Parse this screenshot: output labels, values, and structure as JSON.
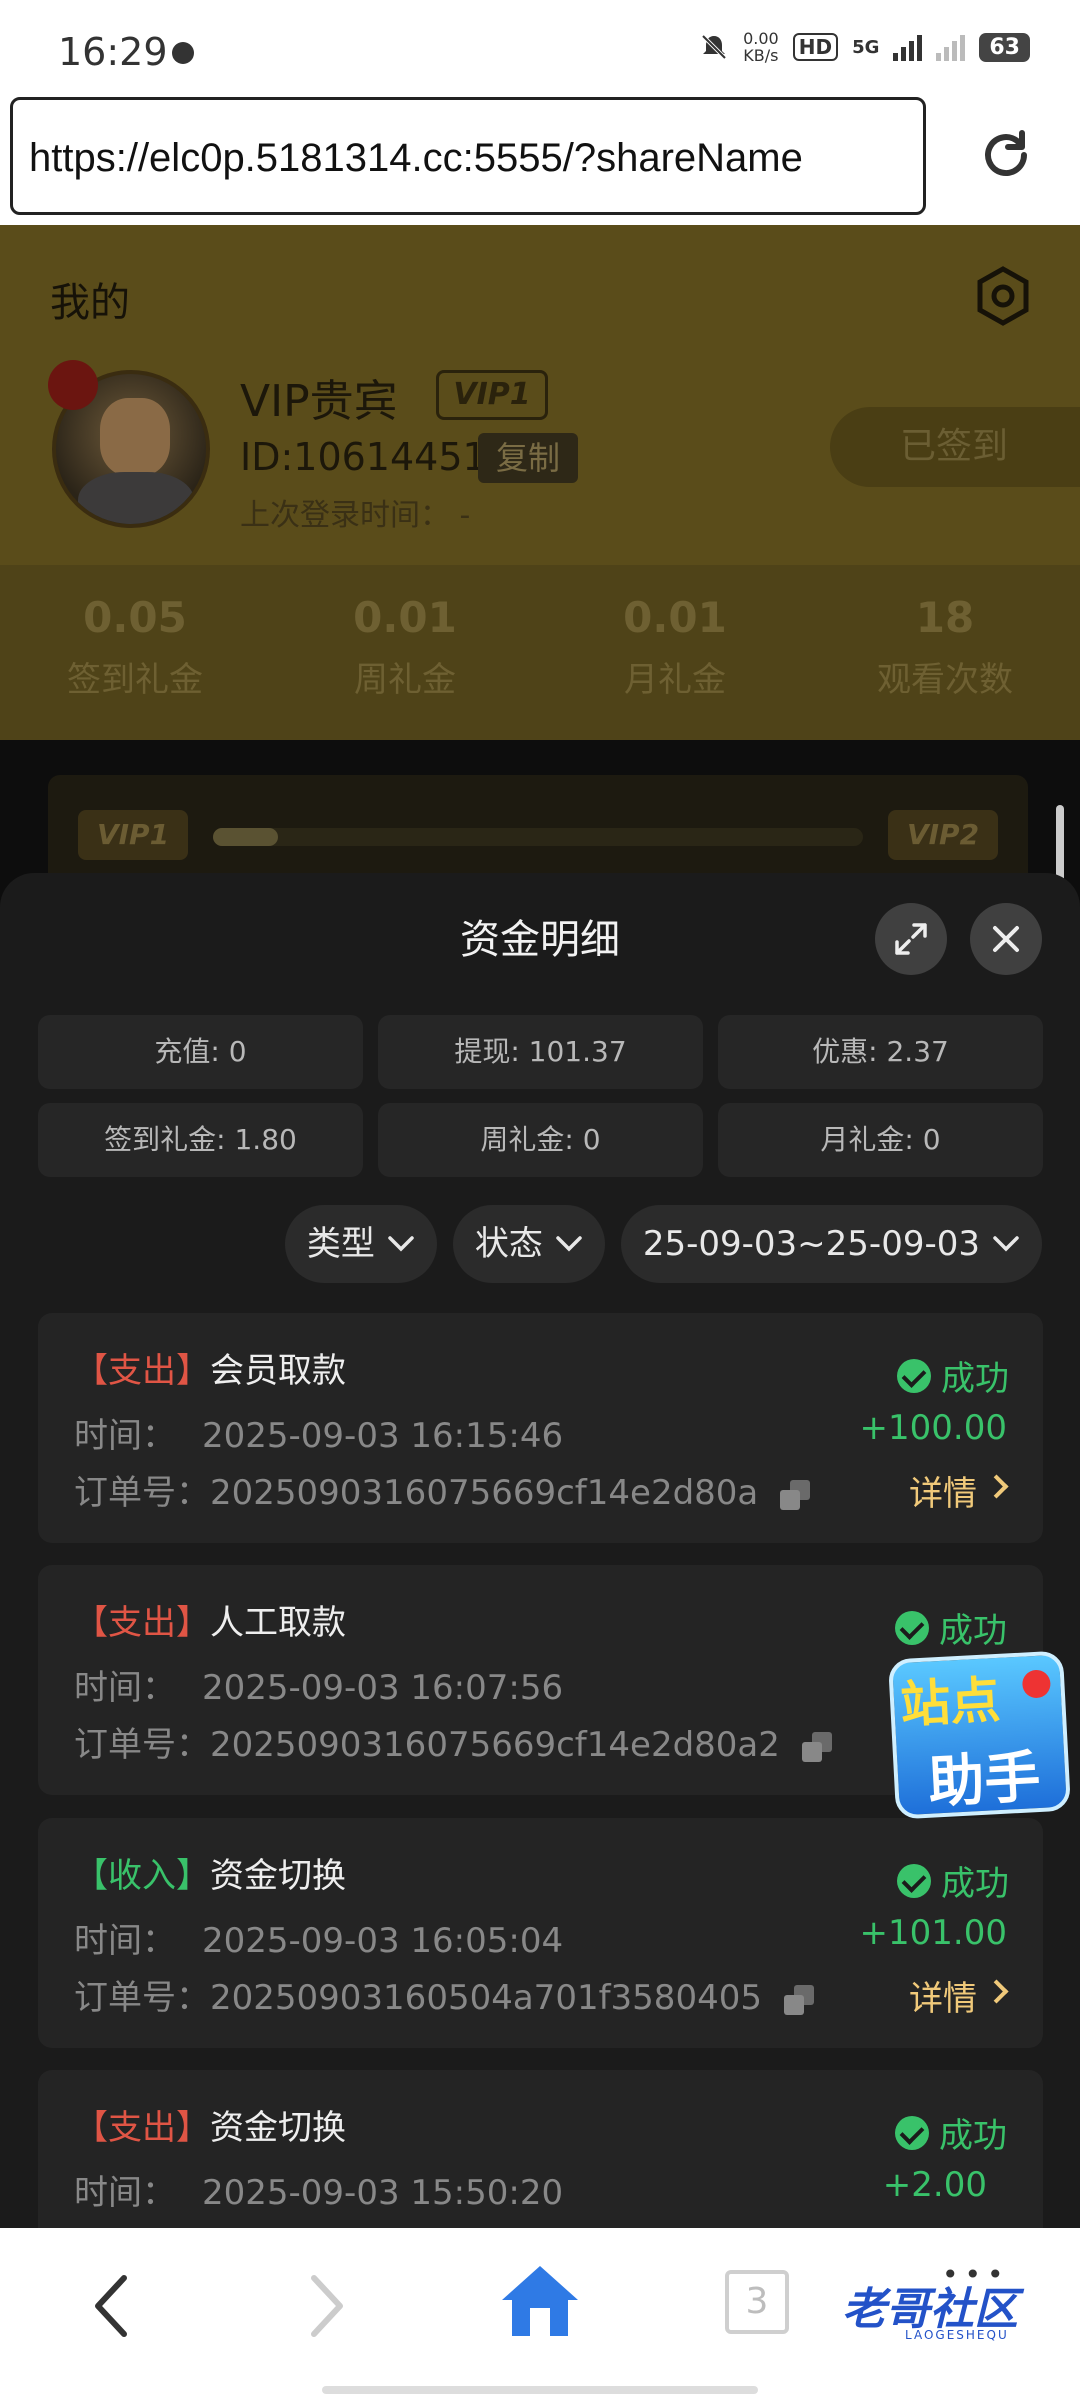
{
  "statusbar": {
    "time": "16:29",
    "net_speed_value": "0.00",
    "net_speed_unit": "KB/s",
    "hd_label": "HD",
    "network": "5G",
    "battery": "63"
  },
  "browser": {
    "url": "https://elc0p.5181314.cc:5555/?shareName"
  },
  "profile": {
    "page_title": "我的",
    "name": "VIP贵宾",
    "vip_badge": "VIP1",
    "id_text": "ID:10614451",
    "copy_label": "复制",
    "last_login": "上次登录时间： -",
    "signed_label": "已签到"
  },
  "stats": [
    {
      "value": "0.05",
      "label": "签到礼金"
    },
    {
      "value": "0.01",
      "label": "周礼金"
    },
    {
      "value": "0.01",
      "label": "月礼金"
    },
    {
      "value": "18",
      "label": "观看次数"
    }
  ],
  "vip_progress": {
    "from": "VIP1",
    "to": "VIP2",
    "progress": 0.1
  },
  "sheet": {
    "title": "资金明细",
    "summary": [
      "充值: 0",
      "提现: 101.37",
      "优惠: 2.37",
      "签到礼金: 1.80",
      "周礼金: 0",
      "月礼金: 0"
    ],
    "filters": {
      "type": "类型",
      "status": "状态",
      "date_range": "25-09-03~25-09-03"
    },
    "records": [
      {
        "tag": "【支出】",
        "kind": "out",
        "title": "会员取款",
        "time_label": "时间：",
        "time": "2025-09-03 16:15:46",
        "order_label": "订单号：",
        "order": "2025090316075669cf14e2d80a",
        "status": "成功",
        "amount": "+100.00",
        "detail": "详情"
      },
      {
        "tag": "【支出】",
        "kind": "out",
        "title": "人工取款",
        "time_label": "时间：",
        "time": "2025-09-03 16:07:56",
        "order_label": "订单号：",
        "order": "2025090316075669cf14e2d80a2",
        "status": "成功",
        "amount": "",
        "detail": ""
      },
      {
        "tag": "【收入】",
        "kind": "in",
        "title": "资金切换",
        "time_label": "时间：",
        "time": "2025-09-03 16:05:04",
        "order_label": "订单号：",
        "order": "20250903160504a701f3580405",
        "status": "成功",
        "amount": "+101.00",
        "detail": "详情"
      },
      {
        "tag": "【支出】",
        "kind": "out",
        "title": "资金切换",
        "time_label": "时间：",
        "time": "2025-09-03 15:50:20",
        "order_label": "",
        "order": "",
        "status": "成功",
        "amount": "+2.00",
        "detail": ""
      }
    ]
  },
  "assistant": {
    "line1": "站点",
    "line2": "助手"
  },
  "bottomnav": {
    "tabs_count": "3",
    "brand": "老哥社区",
    "brand_sub": "LAOGESHEQU"
  },
  "colors": {
    "success": "#39c26a",
    "expense": "#e05545",
    "income": "#39c26a",
    "detail_link": "#f0c97a",
    "accent_blue": "#2f7ae5"
  }
}
